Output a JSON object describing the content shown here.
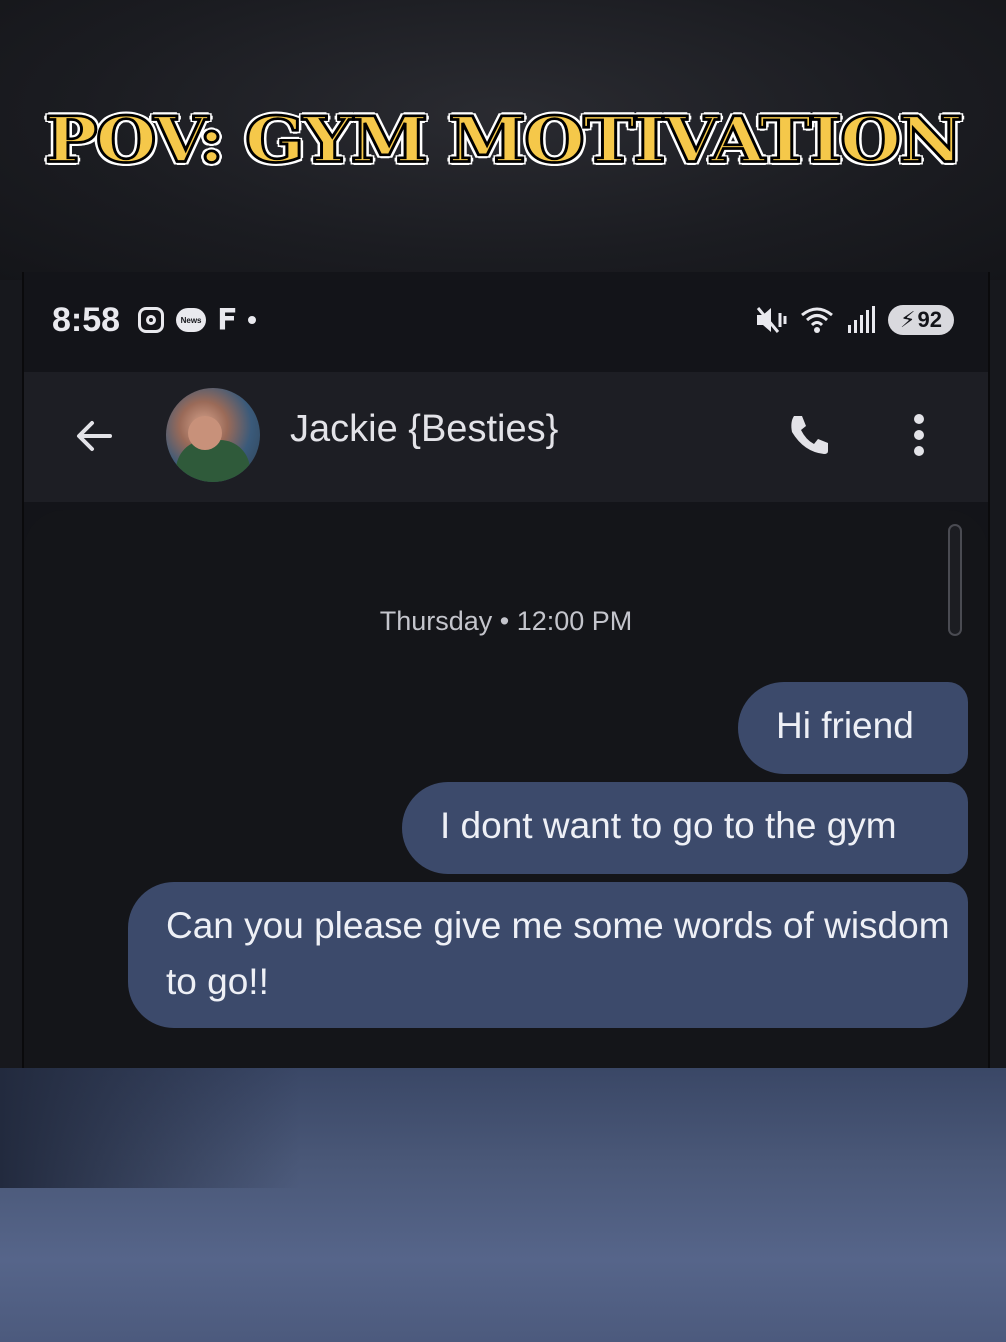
{
  "overlay": {
    "title": "POV: GYM MOTIVATION"
  },
  "status_bar": {
    "time": "8:58",
    "notification_icons": [
      "instagram-icon",
      "news-icon",
      "f-app-icon",
      "dot-icon"
    ],
    "news_label": "News",
    "right_icons": [
      "mute-vibrate-icon",
      "wifi-icon",
      "signal-icon"
    ],
    "battery": "92"
  },
  "header": {
    "contact_name": "Jackie {Besties}",
    "back_icon": "arrow-back-icon",
    "call_icon": "phone-icon",
    "menu_icon": "more-vert-icon"
  },
  "conversation": {
    "timestamp": "Thursday • 12:00 PM",
    "messages": [
      {
        "text": "Hi friend"
      },
      {
        "text": "I dont want to go to the gym"
      },
      {
        "text": "Can you please give me some words of wisdom to go!!"
      }
    ]
  },
  "colors": {
    "title_fill": "#f5c84a",
    "bubble": "#3c4a6b",
    "background": "#141519"
  }
}
